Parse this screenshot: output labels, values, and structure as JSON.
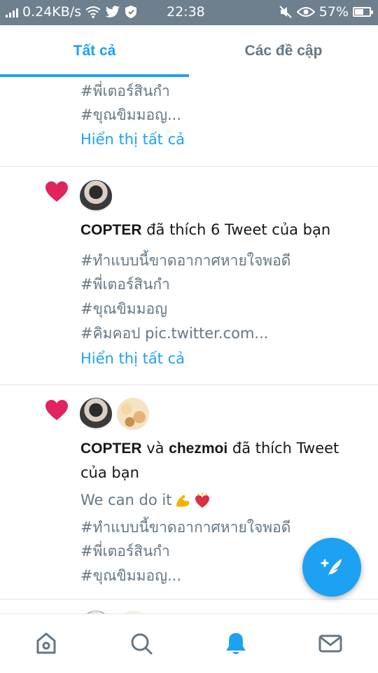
{
  "status_bar": {
    "network_speed": "0.24KB/s",
    "time": "22:38",
    "battery": "57%"
  },
  "tabs": [
    {
      "label": "Tất cả"
    },
    {
      "label": "Các đề cập"
    }
  ],
  "notification_0": {
    "lines": [
      "#พี่เตอร์สินกำ",
      "#ขุณขิมมอญ..."
    ],
    "show_all": "Hiển thị tất cả"
  },
  "notification_1": {
    "actor": "COPTER",
    "action": " đã thích 6 Tweet của bạn",
    "lines": [
      "#ทำแบบนี้ขาดอากาศหายใจพอดี",
      "#พี่เตอร์สินกำ",
      "#ขุณขิมมอญ",
      "#คิมคอป pic.twitter.com..."
    ],
    "show_all": "Hiển thị tất cả"
  },
  "notification_2": {
    "actor1": "COPTER",
    "connector": " và ",
    "actor2": "chezmoi",
    "action": " đã thích Tweet",
    "action_cont": "của bạn",
    "tweet_text": "We can do it",
    "lines": [
      "#ทำแบบนี้ขาดอากาศหายใจพอดี",
      "#พี่เตอร์สินกำ",
      "#ขุณขิมมอญ..."
    ]
  },
  "colors": {
    "accent": "#1da1f2",
    "heart": "#e0245e",
    "status_bar": "#6e7f8e"
  },
  "icons": [
    "home-icon",
    "search-icon",
    "notifications-bell-icon",
    "messages-icon",
    "compose-icon"
  ]
}
